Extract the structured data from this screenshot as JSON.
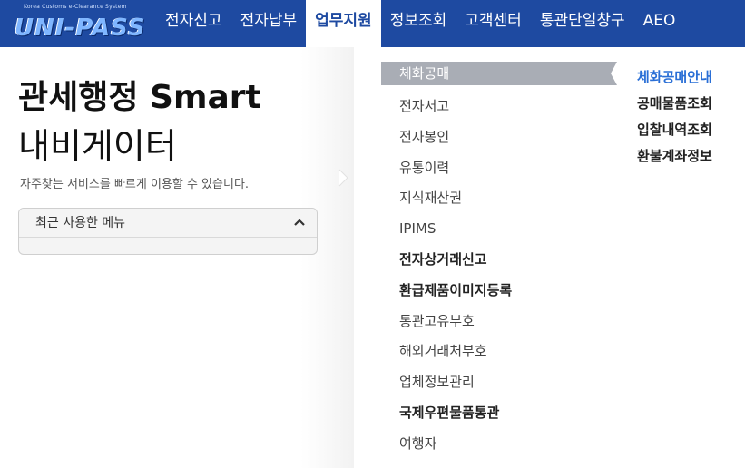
{
  "logo": {
    "subtitle": "Korea Customs e-Clearance System",
    "name": "UNI-PASS"
  },
  "nav": {
    "items": [
      {
        "label": "전자신고"
      },
      {
        "label": "전자납부"
      },
      {
        "label": "업무지원"
      },
      {
        "label": "정보조회"
      },
      {
        "label": "고객센터"
      },
      {
        "label": "통관단일창구"
      },
      {
        "label": "AEO"
      }
    ],
    "active_index": 2
  },
  "left": {
    "title_line1": "관세행정 Smart",
    "title_line2": "내비게이터",
    "description": "자주찾는 서비스를 빠르게 이용할 수 있습니다.",
    "recent_menu_label": "최근 사용한 메뉴"
  },
  "menu": {
    "items": [
      {
        "label": "체화공매",
        "state": "active"
      },
      {
        "label": "전자서고",
        "state": "normal"
      },
      {
        "label": "전자봉인",
        "state": "normal"
      },
      {
        "label": "유통이력",
        "state": "normal"
      },
      {
        "label": "지식재산권",
        "state": "normal"
      },
      {
        "label": "IPIMS",
        "state": "normal"
      },
      {
        "label": "전자상거래신고",
        "state": "bold"
      },
      {
        "label": "환급제품이미지등록",
        "state": "bold"
      },
      {
        "label": "통관고유부호",
        "state": "normal"
      },
      {
        "label": "해외거래처부호",
        "state": "normal"
      },
      {
        "label": "업체정보관리",
        "state": "normal"
      },
      {
        "label": "국제우편물품통관",
        "state": "bold"
      },
      {
        "label": "여행자",
        "state": "normal"
      }
    ]
  },
  "submenu": {
    "items": [
      {
        "label": "체화공매안내",
        "active": true
      },
      {
        "label": "공매물품조회",
        "active": false
      },
      {
        "label": "입찰내역조회",
        "active": false
      },
      {
        "label": "환불계좌정보",
        "active": false
      }
    ]
  },
  "colors": {
    "header_bg": "#1e4aa1",
    "active_menu_bg": "#a9adb5",
    "submenu_active": "#2a6fd6"
  }
}
